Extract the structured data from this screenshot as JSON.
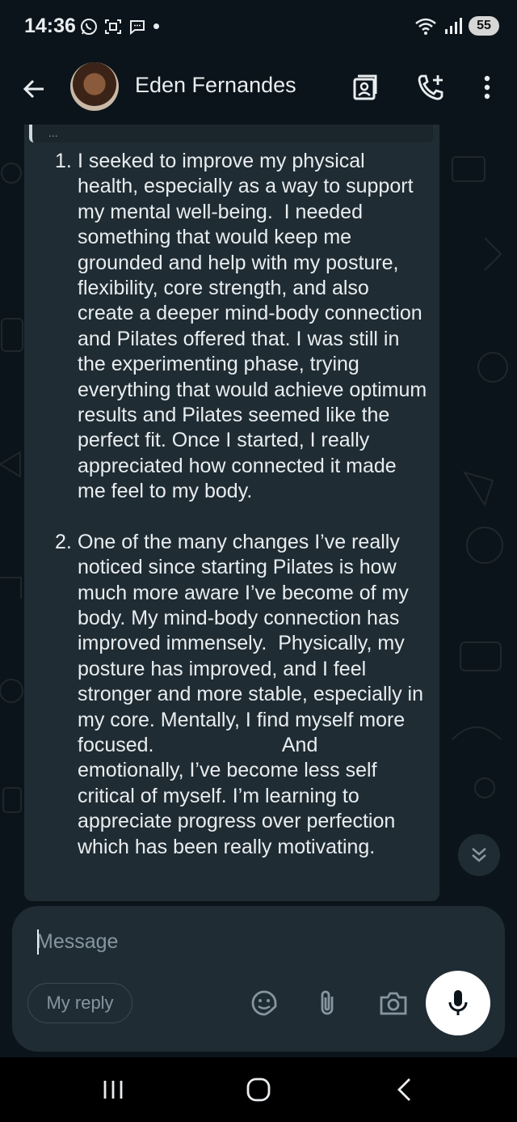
{
  "status_bar": {
    "time": "14:36",
    "battery": "55",
    "icons": [
      "whatsapp-icon",
      "screenshot-icon",
      "chat-bubble-icon",
      "wifi-icon",
      "signal-icon"
    ]
  },
  "header": {
    "contact_name": "Eden Fernandes",
    "actions": [
      "contact-card-icon",
      "add-call-icon",
      "more-vert-icon"
    ]
  },
  "chat": {
    "quoted_text": "...",
    "items": [
      {
        "number": "1.",
        "text": "I seeked to improve my physical health, especially as a way to support my mental well-being.  I needed something that would keep me grounded and help with my posture, flexibility, core strength, and also create a deeper mind-body connection and Pilates offered that. I was still in the experimenting phase, trying everything that would achieve optimum results and Pilates seemed like the perfect fit. Once I started, I really appreciated how connected it made me feel to my body."
      },
      {
        "number": "2.",
        "text": "One of the many changes I’ve really noticed since starting Pilates is how much more aware I’ve become of my body. My mind-body connection has improved immensely.  Physically, my posture has improved, and I feel stronger and more stable, especially in my core. Mentally, I find myself more focused.                       And emotionally, I’ve become less self critical of myself. I’m learning to appreciate progress over perfection which has been really motivating."
      }
    ]
  },
  "composer": {
    "placeholder": "Message",
    "reply_chip": "My reply"
  },
  "colors": {
    "background": "#0b141a",
    "bubble": "#1f2c34",
    "text": "#e9edef",
    "muted": "#8696a0"
  }
}
